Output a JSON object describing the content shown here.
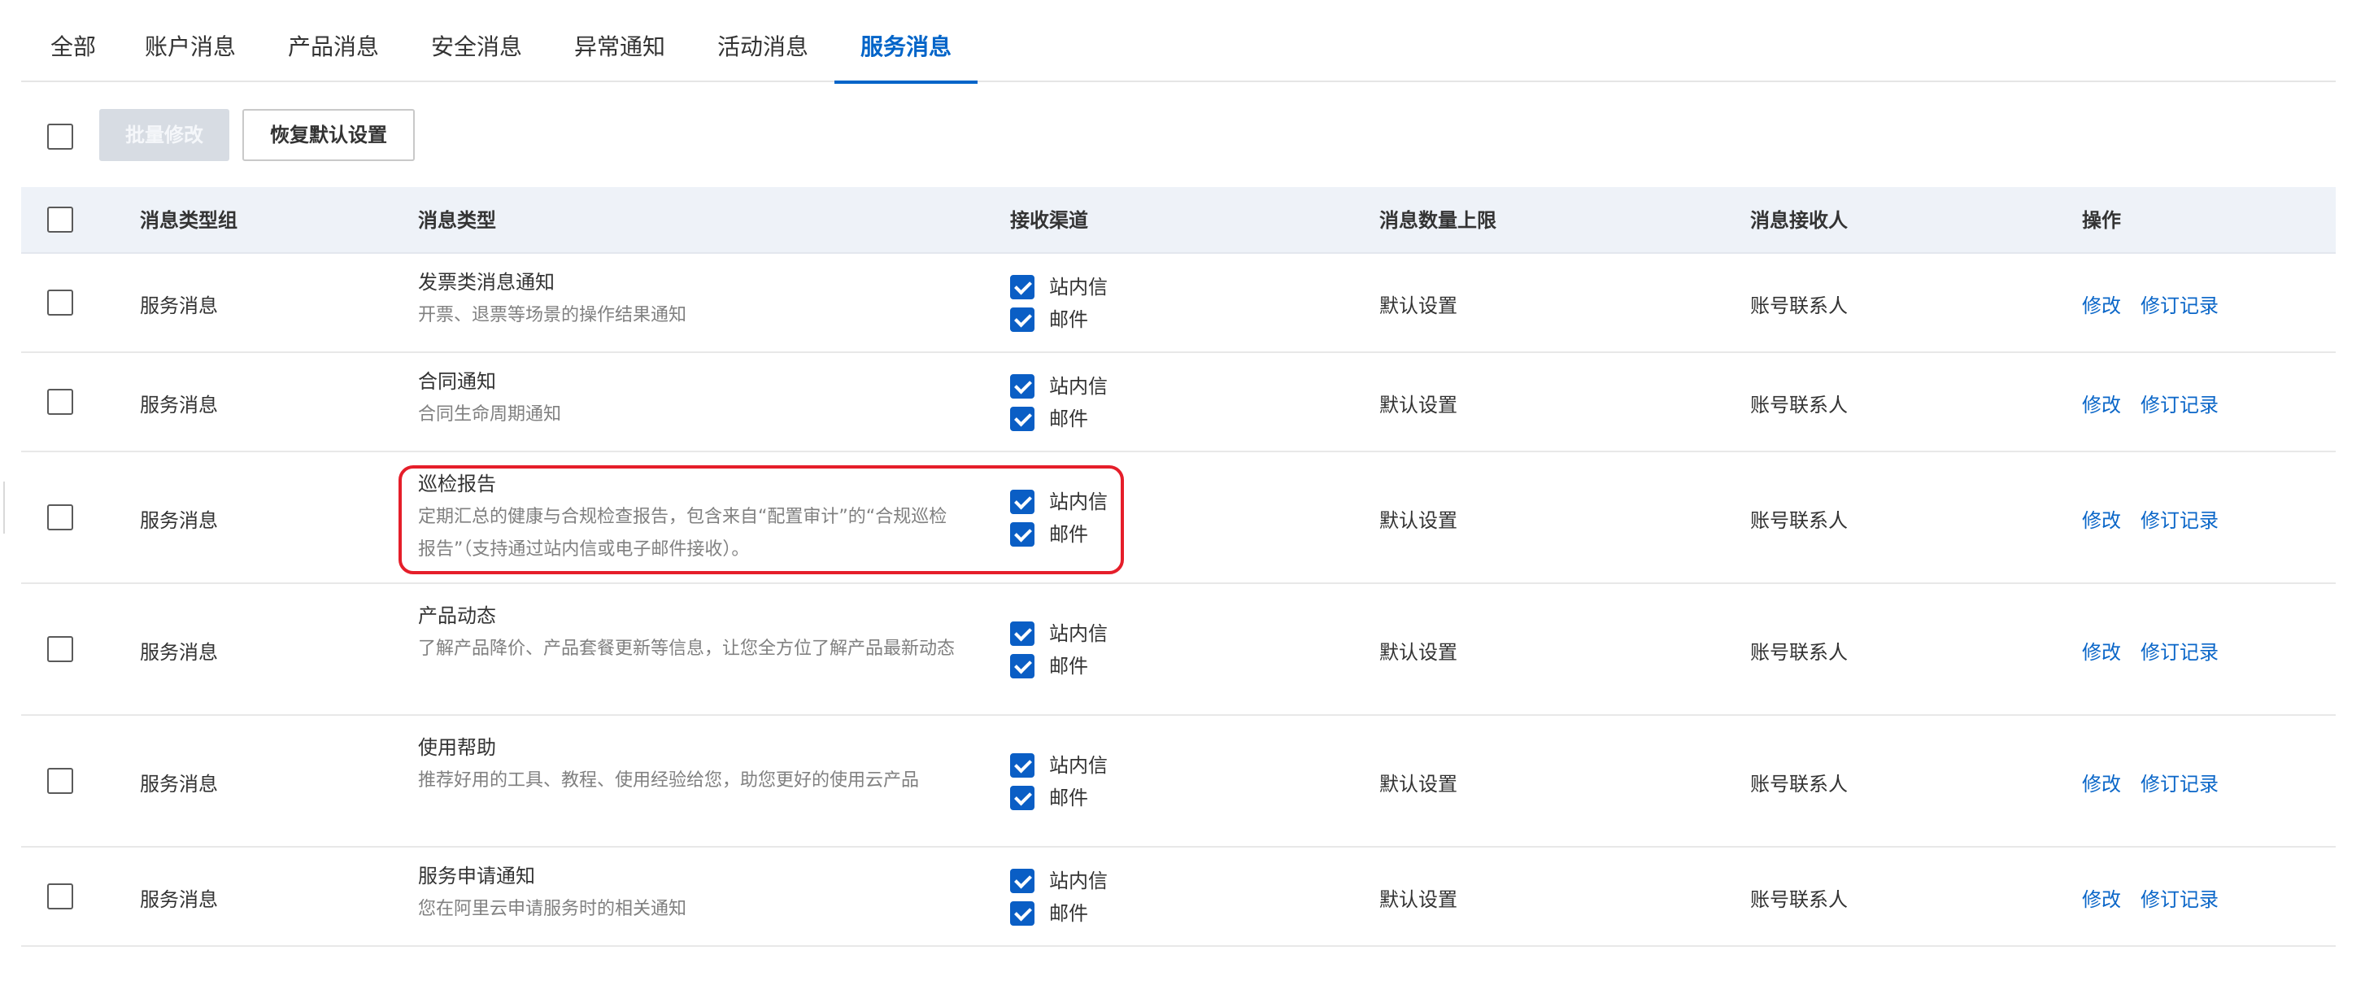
{
  "tabs": [
    {
      "label": "全部"
    },
    {
      "label": "账户消息"
    },
    {
      "label": "产品消息"
    },
    {
      "label": "安全消息"
    },
    {
      "label": "异常通知"
    },
    {
      "label": "活动消息"
    },
    {
      "label": "服务消息",
      "active": true
    }
  ],
  "toolbar": {
    "batch_edit_label": "批量修改",
    "restore_default_label": "恢复默认设置"
  },
  "table": {
    "headers": {
      "group": "消息类型组",
      "type": "消息类型",
      "channel": "接收渠道",
      "limit": "消息数量上限",
      "receiver": "消息接收人",
      "action": "操作"
    },
    "rows": [
      {
        "group": "服务消息",
        "title": "发票类消息通知",
        "desc": "开票、退票等场景的操作结果通知",
        "channels": [
          "站内信",
          "邮件"
        ],
        "limit": "默认设置",
        "receiver": "账号联系人",
        "edit": "修改",
        "history": "修订记录"
      },
      {
        "group": "服务消息",
        "title": "合同通知",
        "desc": "合同生命周期通知",
        "channels": [
          "站内信",
          "邮件"
        ],
        "limit": "默认设置",
        "receiver": "账号联系人",
        "edit": "修改",
        "history": "修订记录"
      },
      {
        "group": "服务消息",
        "title": "巡检报告",
        "desc": "定期汇总的健康与合规检查报告，包含来自“配置审计”的“合规巡检报告”（支持通过站内信或电子邮件接收）。",
        "channels": [
          "站内信",
          "邮件"
        ],
        "limit": "默认设置",
        "receiver": "账号联系人",
        "edit": "修改",
        "history": "修订记录"
      },
      {
        "group": "服务消息",
        "title": "产品动态",
        "desc": "了解产品降价、产品套餐更新等信息，让您全方位了解产品最新动态",
        "channels": [
          "站内信",
          "邮件"
        ],
        "limit": "默认设置",
        "receiver": "账号联系人",
        "edit": "修改",
        "history": "修订记录"
      },
      {
        "group": "服务消息",
        "title": "使用帮助",
        "desc": "推荐好用的工具、教程、使用经验给您，助您更好的使用云产品",
        "channels": [
          "站内信",
          "邮件"
        ],
        "limit": "默认设置",
        "receiver": "账号联系人",
        "edit": "修改",
        "history": "修订记录"
      },
      {
        "group": "服务消息",
        "title": "服务申请通知",
        "desc": "您在阿里云申请服务时的相关通知",
        "channels": [
          "站内信",
          "邮件"
        ],
        "limit": "默认设置",
        "receiver": "账号联系人",
        "edit": "修改",
        "history": "修订记录"
      }
    ]
  },
  "colors": {
    "accent": "#0064c8",
    "highlight_border": "#e51e2a",
    "header_bg": "#eef2f8",
    "checked_box": "#0a5ec5"
  }
}
